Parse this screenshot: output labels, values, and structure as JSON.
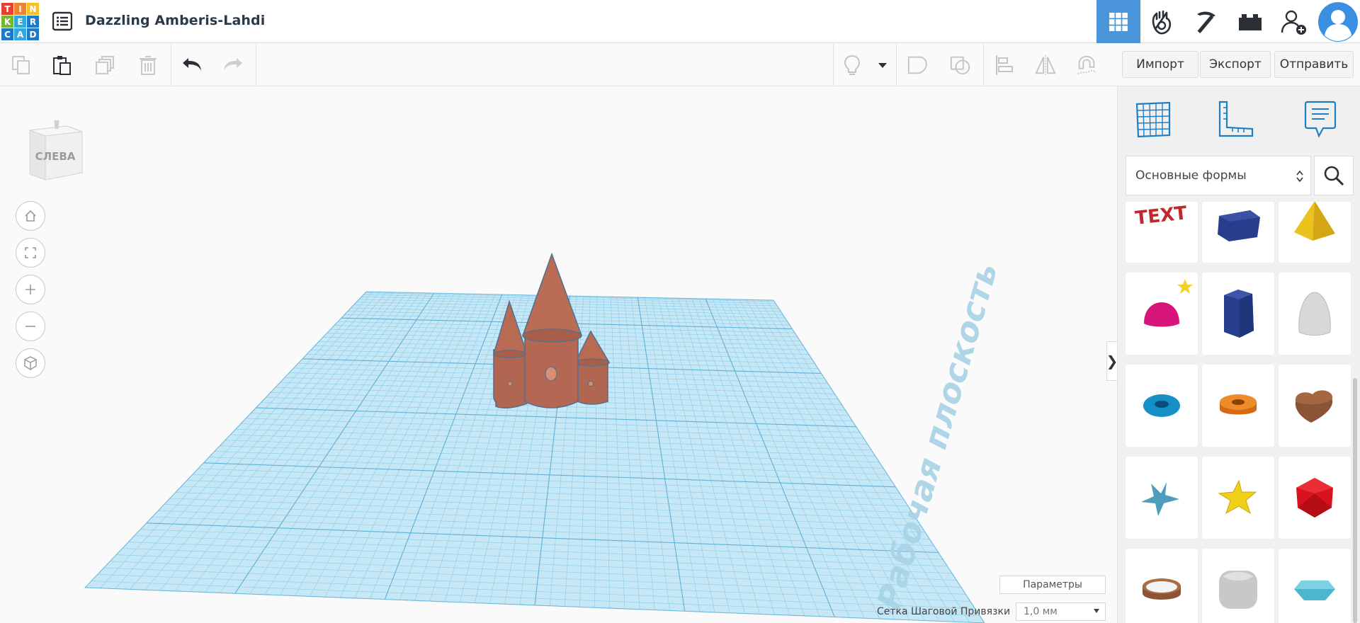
{
  "app": {
    "logo_letters": [
      "T",
      "I",
      "N",
      "K",
      "E",
      "R",
      "C",
      "A",
      "D"
    ],
    "logo_colors": [
      "#e8402f",
      "#f08332",
      "#f6c223",
      "#77b82d",
      "#32a9dc",
      "#1f78c8",
      "#1f78c8",
      "#32a9dc",
      "#1f78c8"
    ],
    "design_title": "Dazzling Amberis-Lahdi"
  },
  "top_icons": [
    {
      "name": "3d-design-view-icon",
      "active": true
    },
    {
      "name": "circuits-icon",
      "active": false
    },
    {
      "name": "codeblocks-pickaxe-icon",
      "active": false
    },
    {
      "name": "bricks-icon",
      "active": false
    },
    {
      "name": "invite-user-icon",
      "active": false
    },
    {
      "name": "user-avatar-icon",
      "active": false
    }
  ],
  "toolbar": {
    "icons": [
      "copy-icon",
      "paste-icon",
      "duplicate-icon",
      "delete-icon",
      "undo-icon",
      "redo-icon",
      "light-bulb-icon",
      "dropdown-arrow-icon",
      "group-icon",
      "ungroup-icon",
      "align-icon",
      "mirror-icon",
      "cruise-magnet-icon"
    ],
    "import_label": "Импорт",
    "export_label": "Экспорт",
    "send_label": "Отправить"
  },
  "viewport": {
    "viewcube_label": "СЛЕВА",
    "nav_buttons": [
      "home-view-icon",
      "fit-view-icon",
      "zoom-in-icon",
      "zoom-out-icon",
      "perspective-icon"
    ],
    "workplane_label": "Рабочая плоскость",
    "params_label": "Параметры",
    "snap_label": "Сетка Шаговой Привязки",
    "snap_value": "1,0 мм",
    "object_color": "#b86a52",
    "grid_color": "#9fd4ec"
  },
  "side_panel": {
    "tools": [
      "workplane-icon",
      "ruler-icon",
      "notes-icon"
    ],
    "category": "Основные формы",
    "shapes": [
      {
        "name": "text-shape",
        "label": "TEXT"
      },
      {
        "name": "box-navy-shape"
      },
      {
        "name": "pyramid-shape"
      },
      {
        "name": "half-sphere-shape"
      },
      {
        "name": "hexagonal-prism-shape"
      },
      {
        "name": "paraboloid-shape"
      },
      {
        "name": "torus-shape"
      },
      {
        "name": "tube-shape"
      },
      {
        "name": "heart-shape"
      },
      {
        "name": "star-teal-shape"
      },
      {
        "name": "star-yellow-shape"
      },
      {
        "name": "icosahedron-shape"
      },
      {
        "name": "ring-shape"
      },
      {
        "name": "rounded-cube-shape"
      },
      {
        "name": "gem-shape"
      }
    ]
  }
}
